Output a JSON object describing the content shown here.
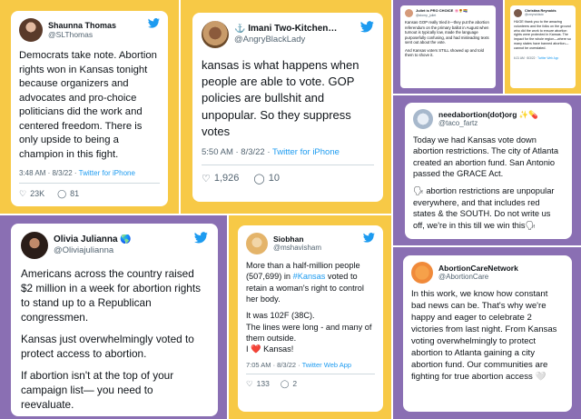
{
  "palette": {
    "yellow": "#f7c946",
    "purple": "#8a6fb3",
    "twitter_blue": "#1d9bf0"
  },
  "tweets": [
    {
      "name": "Shaunna Thomas",
      "handle": "@SLThomas",
      "paragraphs": [
        "Democrats take note. Abortion rights won in Kansas tonight because organizers and advocates and pro-choice politicians did the work and centered freedom. There is only upside to being a champion in this fight."
      ],
      "time": "3:48 AM · 8/3/22 · ",
      "source": "Twitter for iPhone",
      "likes": "23K",
      "replies": "81",
      "icon": "twitter-bird-icon"
    },
    {
      "name": "⚓ Imani Two-Kitchen…",
      "handle": "@AngryBlackLady",
      "paragraphs": [
        "kansas is what happens when people are able to vote. GOP policies are bullshit and unpopular. So they suppress votes"
      ],
      "time": "5:50 AM · 8/3/22 · ",
      "source": "Twitter for iPhone",
      "likes": "1,926",
      "replies": "10",
      "icon": "twitter-bird-icon"
    },
    {
      "name": "Juliet is PRO CHOICE 🌸🌻🏳️‍🌈",
      "handle": "@stomp_juliet",
      "paragraphs": [
        "Kansas GOP really tried it—they put the abortion referendum on the primary ballot in August when turnout is typically low, made the language purposefully confusing, and had misleading texts sent out about the vote.",
        "And Kansas voters STILL showed up and told them to shove it."
      ]
    },
    {
      "name": "Christina Reynolds",
      "handle": "@creynoldsdc",
      "paragraphs": [
        "HUGE thank you to the amazing volunteers and the folks on the ground who did the work to ensure abortion rights were protected in Kansas. The impact for the whole region—where so many states have banned abortion—cannot be overstated."
      ],
      "time": "6:21 AM · 8/3/22 · ",
      "source": "Twitter Web App"
    },
    {
      "name": "needabortion(dot)org ✨💊",
      "handle": "@taco_fartz",
      "paragraphs": [
        "Today we had Kansas vote down abortion restrictions. The city of Atlanta created an abortion fund. San Antonio passed the GRACE Act.",
        "🗣 abortion restrictions are unpopular everywhere, and that includes red states & the SOUTH. Do not write us off, we're in this till we win this🗣"
      ]
    },
    {
      "name": "Olivia Julianna 🌎",
      "handle": "@Oliviajulianna",
      "paragraphs": [
        "Americans across the country raised $2 million in a week for abortion rights to stand up to a Republican congressmen.",
        "Kansas just overwhelmingly voted to protect access to abortion.",
        "If abortion isn't at the top of your campaign list— you need to reevaluate."
      ]
    },
    {
      "name": "Siobhan",
      "handle": "@mshavisham",
      "p1_before": "More than a half-million people (507,699) in ",
      "hashtag": "#Kansas",
      "p1_after": " voted to retain a woman's right to control her body.",
      "p2": "It was 102F (38C).",
      "p3": "The lines were long - and many of them outside.",
      "p4": "I ❤️ Kansas!",
      "time": "7:05 AM · 8/3/22 · ",
      "source": "Twitter Web App",
      "likes": "133",
      "replies": "2"
    },
    {
      "name": "AbortionCareNetwork",
      "handle": "@AbortionCare",
      "paragraphs": [
        "In this work, we know how constant bad news can be. That's why we're happy and eager to celebrate 2 victories from last night. From Kansas voting overwhelmingly to protect abortion to Atlanta gaining a city abortion fund. Our communities are fighting for true abortion access 🤍"
      ]
    }
  ]
}
